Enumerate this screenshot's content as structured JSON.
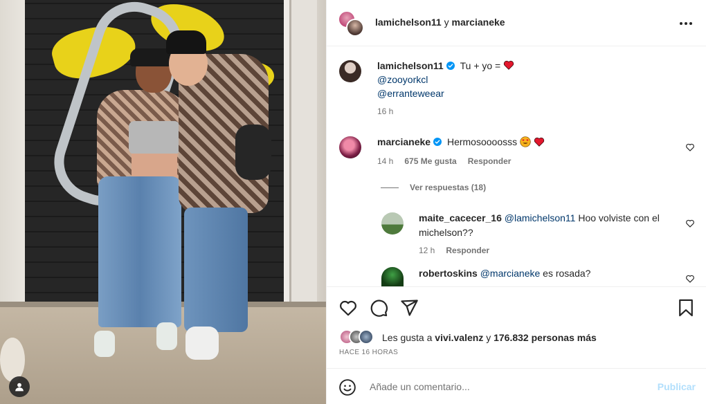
{
  "post": {
    "header": {
      "user1": "lamichelson11",
      "connector": " y ",
      "user2": "marcianeke"
    },
    "caption": {
      "username": "lamichelson11",
      "text": "Tu + yo = ",
      "mention1": "@zooyorkcl",
      "mention2": "@erranteweear",
      "time": "16 h"
    },
    "comments": [
      {
        "username": "marcianeke",
        "text": "Hermosoooosss",
        "time": "14 h",
        "likes": "675 Me gusta",
        "reply": "Responder"
      }
    ],
    "view_replies": "Ver respuestas (18)",
    "replies": [
      {
        "username": "maite_cacecer_16",
        "mention": "@lamichelson11",
        "text_line1": " Hoo volviste con el",
        "text_line2": "michelson??",
        "time": "12 h",
        "reply": "Responder"
      },
      {
        "username": "robertoskins",
        "mention": "@marcianeke",
        "text_line1": " es rosada?"
      }
    ],
    "likes": {
      "prefix": "Les gusta a ",
      "user": "vivi.valenz",
      "middle": " y ",
      "count": "176.832 personas más"
    },
    "time_ago": "HACE 16 HORAS",
    "comment_box": {
      "placeholder": "Añade un comentario...",
      "publish_label": "Publicar"
    }
  },
  "colors": {
    "verified": "#0095f6",
    "heart": "#ed4956",
    "mention": "#00376b",
    "muted": "#737373",
    "publish_disabled": "#b2dffc"
  },
  "icons": [
    "user-tag-icon",
    "more-options-icon",
    "verified-icon",
    "red-heart-icon",
    "heart-eyes-icon",
    "like-icon",
    "comment-icon",
    "share-icon",
    "save-icon",
    "emoji-icon"
  ]
}
